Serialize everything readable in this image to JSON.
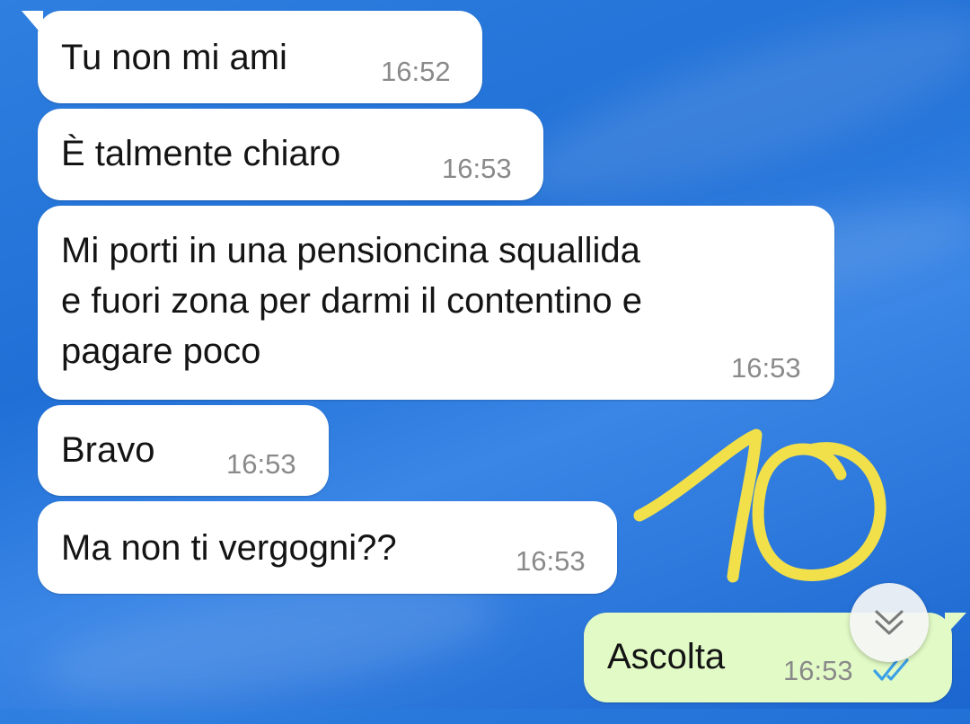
{
  "chat": {
    "messages": [
      {
        "text": "Tu non mi ami",
        "time": "16:52",
        "direction": "incoming"
      },
      {
        "text": "È talmente chiaro",
        "time": "16:53",
        "direction": "incoming"
      },
      {
        "text": "Mi porti in una pensioncina squallida\ne fuori zona per darmi il contentino e\npagare poco",
        "time": "16:53",
        "direction": "incoming"
      },
      {
        "text": "Bravo",
        "time": "16:53",
        "direction": "incoming"
      },
      {
        "text": "Ma non ti vergogni??",
        "time": "16:53",
        "direction": "incoming"
      },
      {
        "text": "Ascolta",
        "time": "16:53",
        "direction": "outgoing",
        "status": "read"
      }
    ]
  },
  "annotation": {
    "handwritten_text": "10",
    "color": "#f2e04a"
  },
  "colors": {
    "incoming_bubble": "#ffffff",
    "outgoing_bubble": "#e2fbc6",
    "read_ticks": "#3ba0e8",
    "timestamp": "#8a8a8a",
    "background": "#2f7fe0"
  },
  "icons": {
    "scroll_down": "double-chevron-down-icon",
    "read_receipt": "double-check-icon"
  }
}
